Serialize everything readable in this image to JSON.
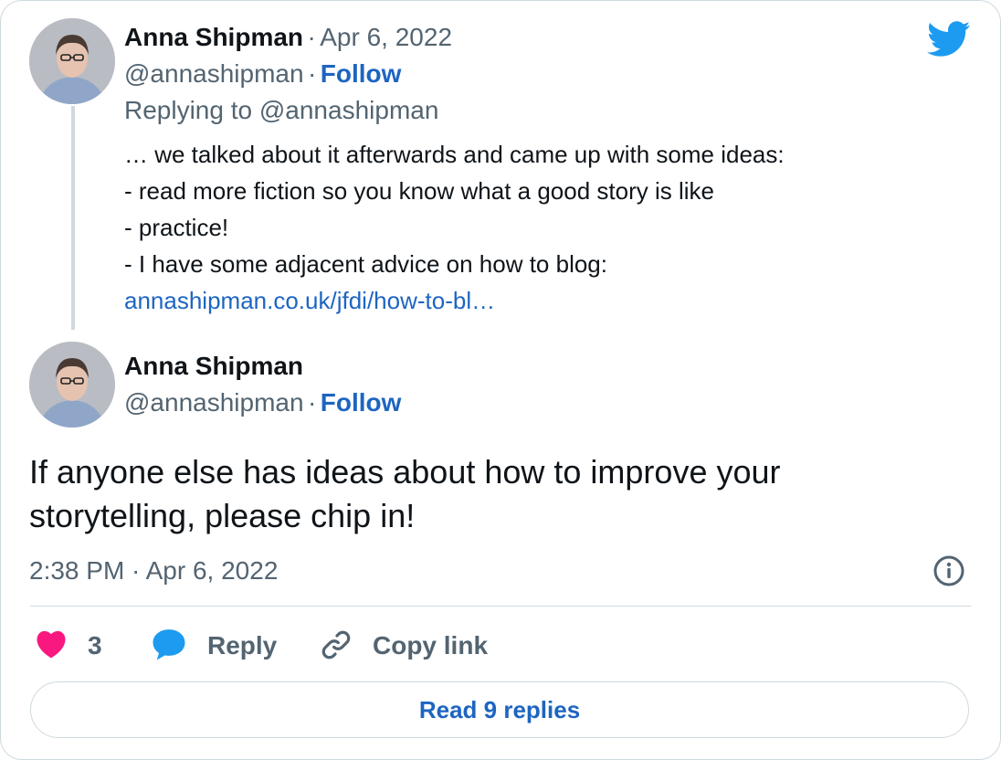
{
  "reply_tweet": {
    "author_name": "Anna Shipman",
    "date": "Apr 6, 2022",
    "handle": "@annashipman",
    "follow_label": "Follow",
    "replying_to": "Replying to @annashipman",
    "lines": [
      "… we talked about it afterwards and came up with some ideas:",
      "- read more fiction so you know what a good story is like",
      "- practice!",
      "- I have some adjacent advice on how to blog:"
    ],
    "link_text": "annashipman.co.uk/jfdi/how-to-bl…"
  },
  "main_tweet": {
    "author_name": "Anna Shipman",
    "handle": "@annashipman",
    "follow_label": "Follow",
    "text_line1": "If anyone else has ideas about how to improve your",
    "text_line2": "storytelling, please chip in!",
    "timestamp": "2:38 PM · Apr 6, 2022"
  },
  "separator": "·",
  "actions": {
    "like_count": "3",
    "reply_label": "Reply",
    "copy_link_label": "Copy link"
  },
  "read_replies_label": "Read 9 replies",
  "icons": {
    "brand": "twitter-bird-icon",
    "info": "info-icon",
    "like": "heart-icon",
    "reply": "speech-bubble-icon",
    "copy_link": "link-icon"
  },
  "colors": {
    "twitter_blue": "#1d9bf0",
    "link_blue": "#1d65c1",
    "heart_pink": "#f91880",
    "muted_gray": "#536471",
    "border": "#cfd9de"
  }
}
